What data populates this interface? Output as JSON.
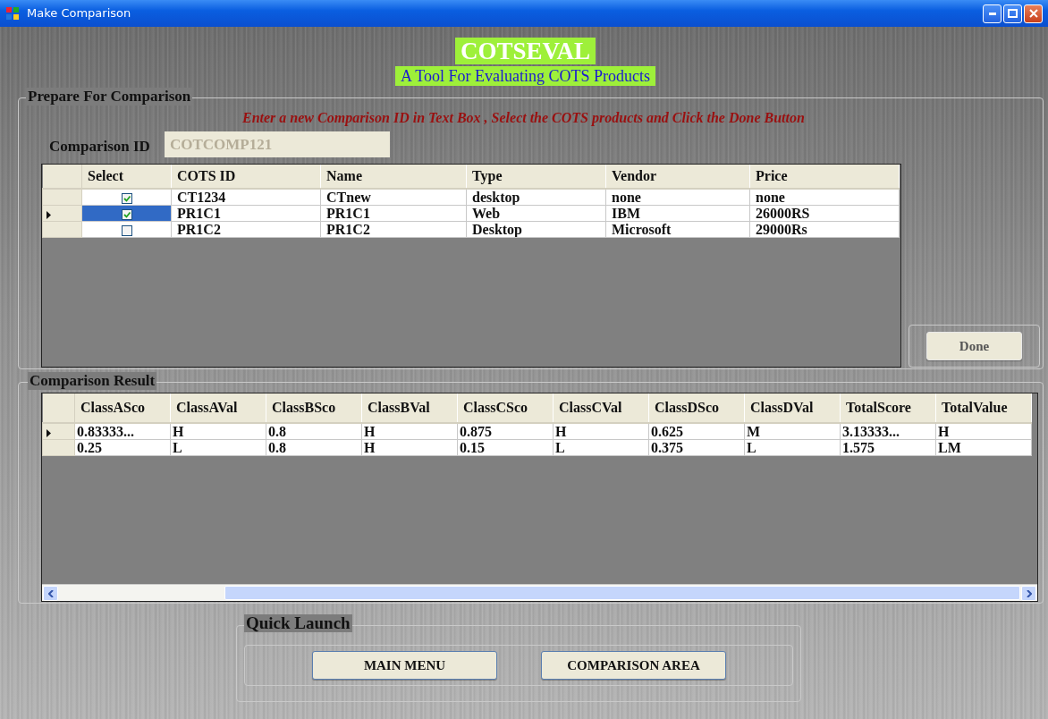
{
  "window": {
    "title": "Make Comparison"
  },
  "header": {
    "title": "COTSEVAL",
    "subtitle": "A Tool For Evaluating COTS Products"
  },
  "prepare": {
    "legend": "Prepare For Comparison",
    "instruction": "Enter a new Comparison ID in Text Box , Select the COTS products and Click the Done Button",
    "id_label": "Comparison ID",
    "id_field": {
      "value": "COTCOMP121",
      "disabled": true
    },
    "select_column": "Select",
    "columns": [
      "COTS ID",
      "Name",
      "Type",
      "Vendor",
      "Price"
    ],
    "rows": [
      {
        "selected": false,
        "checked": true,
        "cells": [
          "CT1234",
          "CTnew",
          "desktop",
          "none",
          "none"
        ]
      },
      {
        "selected": true,
        "checked": true,
        "cells": [
          "PR1C1",
          "PR1C1",
          "Web",
          "IBM",
          "26000RS"
        ]
      },
      {
        "selected": false,
        "checked": false,
        "cells": [
          "PR1C2",
          "PR1C2",
          "Desktop",
          "Microsoft",
          "29000Rs"
        ]
      }
    ],
    "done_button": "Done"
  },
  "result": {
    "legend": "Comparison Result",
    "columns": [
      "ClassASco",
      "ClassAVal",
      "ClassBSco",
      "ClassBVal",
      "ClassCSco",
      "ClassCVal",
      "ClassDSco",
      "ClassDVal",
      "TotalScore",
      "TotalValue"
    ],
    "rows": [
      {
        "selected": true,
        "cells": [
          "0.83333...",
          "H",
          "0.8",
          "H",
          "0.875",
          "H",
          "0.625",
          "M",
          "3.13333...",
          "H"
        ]
      },
      {
        "selected": false,
        "cells": [
          "0.25",
          "L",
          "0.8",
          "H",
          "0.15",
          "L",
          "0.375",
          "L",
          "1.575",
          "LM"
        ]
      }
    ]
  },
  "quick_launch": {
    "legend": "Quick Launch",
    "buttons": [
      "MAIN MENU",
      "COMPARISON AREA"
    ]
  }
}
